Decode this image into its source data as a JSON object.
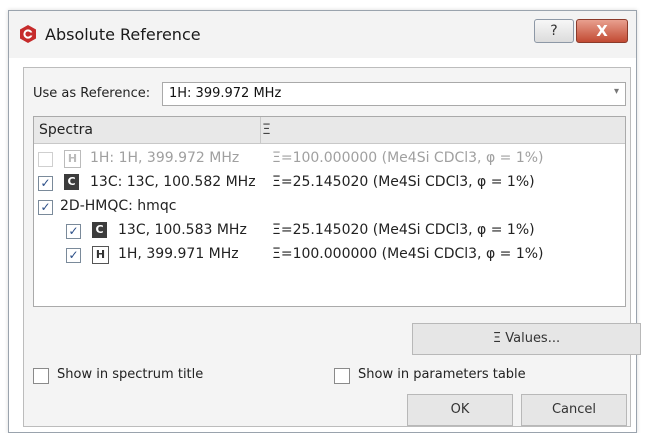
{
  "window": {
    "title": "Absolute Reference",
    "help_glyph": "?",
    "close_glyph": "X",
    "brand_color": "#c62b2b"
  },
  "reference": {
    "label": "Use as Reference:",
    "value": "1H: 399.972 MHz",
    "arrow": "▾"
  },
  "tree": {
    "headers": {
      "spectra": "Spectra",
      "xi": "Ξ"
    },
    "rows": [
      {
        "label": "1H: 1H, 399.972 MHz",
        "value": "Ξ=100.000000 (Me4Si CDCl3, φ = 1%)",
        "nucleus": "H",
        "checked": false,
        "enabled": false
      },
      {
        "label": "13C: 13C, 100.582 MHz",
        "value": "Ξ=25.145020 (Me4Si CDCl3, φ = 1%)",
        "nucleus": "C",
        "checked": true,
        "enabled": true
      },
      {
        "label": "2D-HMQC: hmqc",
        "value": "",
        "nucleus": "",
        "checked": true,
        "enabled": true
      },
      {
        "label": "13C, 100.583 MHz",
        "value": "Ξ=25.145020 (Me4Si CDCl3, φ = 1%)",
        "nucleus": "C",
        "checked": true,
        "enabled": true
      },
      {
        "label": "1H, 399.971 MHz",
        "value": "Ξ=100.000000 (Me4Si CDCl3, φ = 1%)",
        "nucleus": "H",
        "checked": true,
        "enabled": true
      }
    ]
  },
  "buttons": {
    "xi_values": "Ξ Values...",
    "ok": "OK",
    "cancel": "Cancel"
  },
  "options": {
    "show_title": "Show in spectrum title",
    "show_params": "Show in parameters table"
  },
  "glyphs": {
    "check": "✓"
  }
}
